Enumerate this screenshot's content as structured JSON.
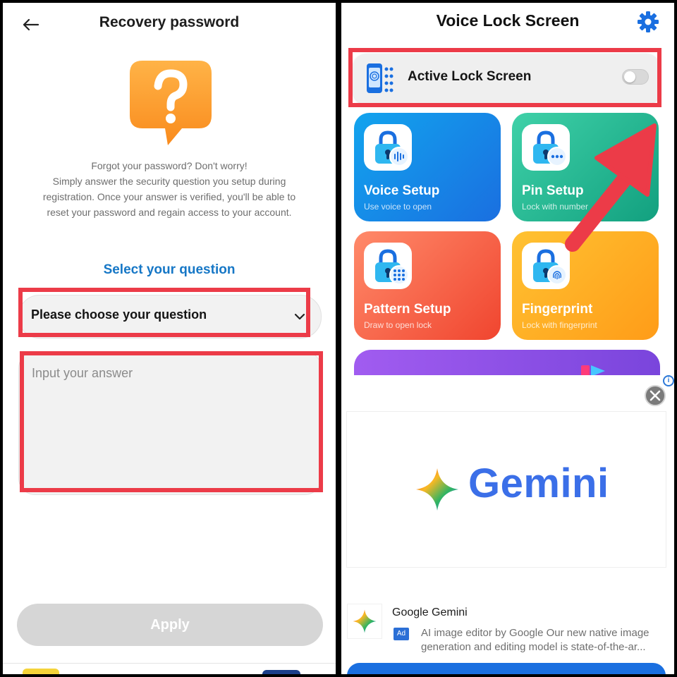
{
  "left": {
    "title": "Recovery password",
    "intro": "Forgot your password? Don't worry!\nSimply answer the security question you setup during registration. Once your answer is verified, you'll be able to reset your password and regain access to your account.",
    "select_label": "Select your question",
    "question_value": "Please choose your question",
    "answer_placeholder": "Input your answer",
    "apply_label": "Apply"
  },
  "right": {
    "title": "Voice Lock Screen",
    "active_label": "Active Lock Screen",
    "active_toggle_on": false,
    "tiles": [
      {
        "title": "Voice Setup",
        "subtitle": "Use voice to open",
        "icon": "microphone-wave-icon"
      },
      {
        "title": "Pin Setup",
        "subtitle": "Lock with number",
        "icon": "pin-dots-icon"
      },
      {
        "title": "Pattern Setup",
        "subtitle": "Draw to open lock",
        "icon": "pattern-grid-icon"
      },
      {
        "title": "Fingerprint",
        "subtitle": "Lock with fingerprint",
        "icon": "fingerprint-icon"
      }
    ],
    "ad": {
      "banner_text": "Gemini",
      "advertiser": "Google Gemini",
      "badge": "Ad",
      "description": "AI image editor by Google Our new native image generation and editing model is state-of-the-ar...",
      "info_icon": "i"
    }
  },
  "colors": {
    "highlight": "#ec3b48",
    "link_blue": "#1677c6",
    "voice": "#1a6fe0",
    "pin": "#12a07f",
    "pattern": "#f0452f",
    "fingerprint": "#ff9c18"
  }
}
